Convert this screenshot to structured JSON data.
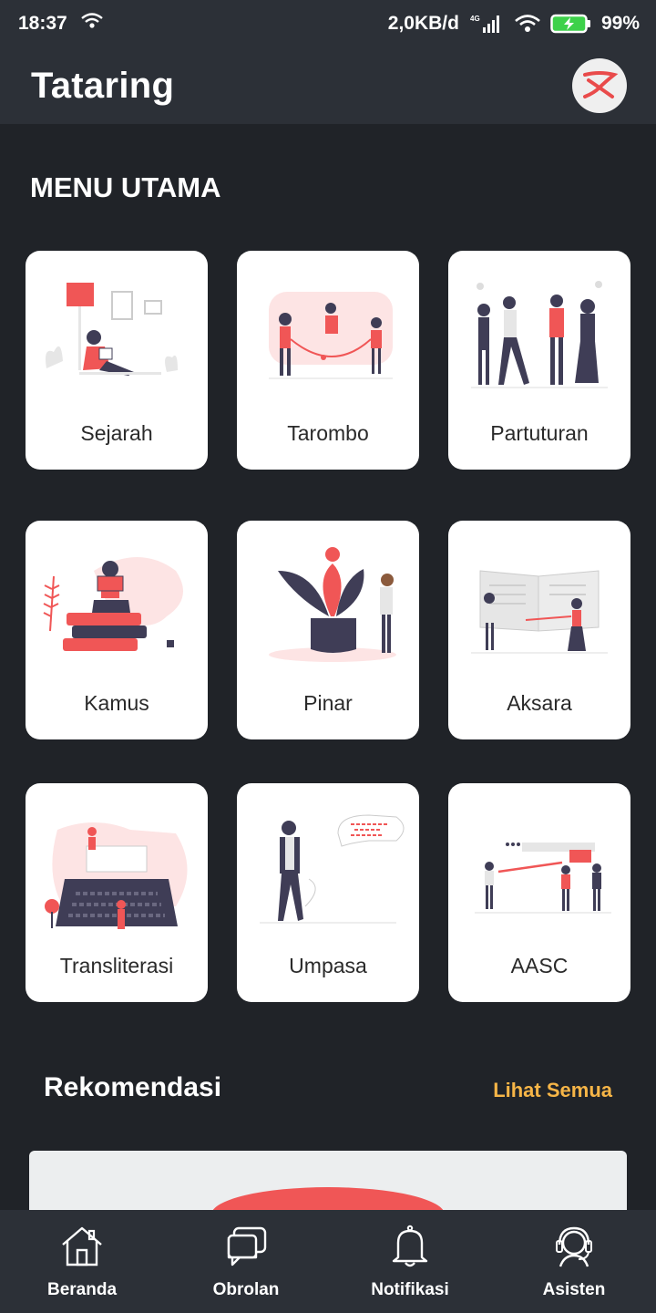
{
  "status": {
    "time": "18:37",
    "net_speed": "2,0KB/d",
    "battery": "99%"
  },
  "app": {
    "title": "Tataring"
  },
  "menu": {
    "title": "MENU UTAMA",
    "items": [
      {
        "label": "Sejarah",
        "icon": "reading-person-illustration"
      },
      {
        "label": "Tarombo",
        "icon": "family-jump-rope-illustration"
      },
      {
        "label": "Partuturan",
        "icon": "people-greeting-illustration"
      },
      {
        "label": "Kamus",
        "icon": "books-reader-illustration"
      },
      {
        "label": "Pinar",
        "icon": "lotus-plant-illustration"
      },
      {
        "label": "Aksara",
        "icon": "open-book-illustration"
      },
      {
        "label": "Transliterasi",
        "icon": "typewriter-illustration"
      },
      {
        "label": "Umpasa",
        "icon": "speaking-man-illustration"
      },
      {
        "label": "AASC",
        "icon": "presentation-illustration"
      }
    ]
  },
  "recommendation": {
    "title": "Rekomendasi",
    "see_all": "Lihat Semua"
  },
  "nav": {
    "items": [
      {
        "label": "Beranda",
        "icon": "home-icon"
      },
      {
        "label": "Obrolan",
        "icon": "chat-icon"
      },
      {
        "label": "Notifikasi",
        "icon": "bell-icon"
      },
      {
        "label": "Asisten",
        "icon": "headset-icon"
      }
    ]
  },
  "colors": {
    "accent": "#f05656",
    "link": "#f6b547",
    "background": "#202328",
    "bar": "#2c3037"
  }
}
